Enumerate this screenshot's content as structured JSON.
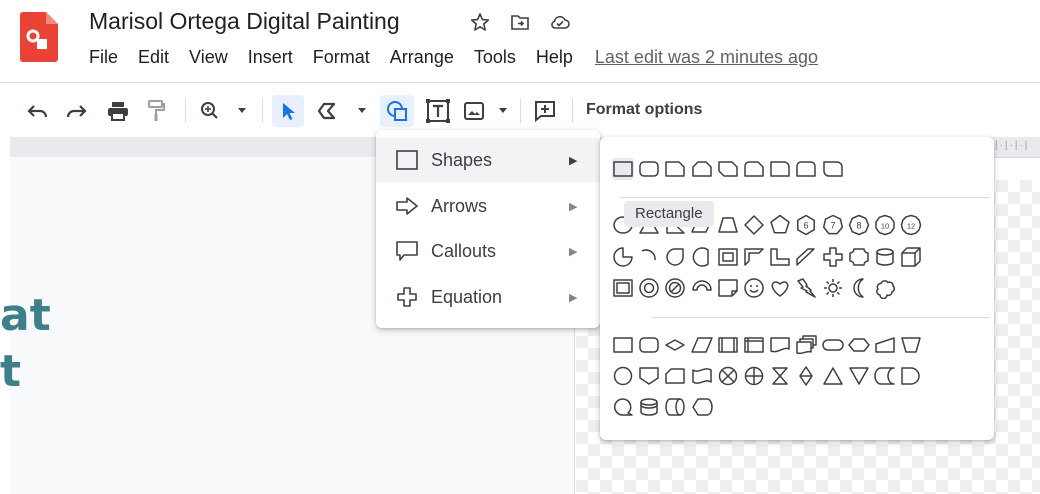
{
  "app": {
    "doc_title": "Marisol Ortega Digital Painting",
    "title_icons": [
      "star-icon",
      "move-to-folder-icon",
      "cloud-status-icon"
    ],
    "logo_icon": "drawings-logo-icon",
    "brand_color": "#ea4335"
  },
  "menubar": {
    "items": [
      "File",
      "Edit",
      "View",
      "Insert",
      "Format",
      "Arrange",
      "Tools",
      "Help"
    ],
    "last_edit": "Last edit was 2 minutes ago"
  },
  "toolbar": {
    "buttons": [
      "undo-icon",
      "redo-icon",
      "print-icon",
      "paint-format-icon",
      "zoom-icon",
      "select-icon",
      "line-icon",
      "shape-icon",
      "text-box-icon",
      "image-icon",
      "add-comment-icon"
    ],
    "format_options": "Format options",
    "active_tool": "shape-icon"
  },
  "background": {
    "fragment_line1": "at",
    "fragment_line2": "t"
  },
  "shape_menu": {
    "items": [
      {
        "label": "Shapes",
        "icon": "rectangle-icon",
        "active": true
      },
      {
        "label": "Arrows",
        "icon": "arrow-right-icon",
        "active": false
      },
      {
        "label": "Callouts",
        "icon": "callout-icon",
        "active": false
      },
      {
        "label": "Equation",
        "icon": "plus-icon",
        "active": false
      }
    ],
    "submenu_arrow": "▶"
  },
  "shapes_panel": {
    "tooltip": "Rectangle",
    "hovered_shape": "rectangle-shape",
    "groups": [
      {
        "name": "shapes",
        "rows": [
          [
            "rectangle",
            "rounded-rectangle",
            "snip-single-corner-rectangle",
            "snip-same-side-corner-rectangle",
            "snip-diagonal-corner-rectangle",
            "snip-and-round-single-corner-rectangle",
            "round-single-corner-rectangle",
            "round-same-side-corner-rectangle",
            "round-diagonal-corner-rectangle"
          ],
          [
            "oval",
            "triangle",
            "right-triangle",
            "parallelogram",
            "trapezoid",
            "diamond",
            "pentagon",
            "hexagon",
            "heptagon",
            "octagon",
            "decagon",
            "dodecagon"
          ],
          [
            "pie",
            "arc",
            "teardrop",
            "chord",
            "frame",
            "half-frame",
            "l-shape",
            "diagonal-stripe",
            "cross",
            "plaque",
            "can",
            "cube"
          ],
          [
            "bevel",
            "donut",
            "no-symbol",
            "block-arc",
            "folded-corner",
            "smiley-face",
            "heart",
            "lightning-bolt",
            "sun",
            "moon",
            "cloud"
          ]
        ]
      },
      {
        "name": "flowchart",
        "rows": [
          [
            "process",
            "alternate-process",
            "decision",
            "data",
            "predefined-process",
            "internal-storage",
            "document",
            "multidocument",
            "terminator",
            "preparation",
            "manual-input",
            "manual-operation"
          ],
          [
            "connector",
            "off-page-connector",
            "card",
            "punched-tape",
            "summing-junction",
            "or",
            "collate",
            "sort",
            "extract",
            "merge",
            "stored-data",
            "delay"
          ],
          [
            "sequential-access-storage",
            "magnetic-disk",
            "direct-access-storage",
            "display"
          ]
        ]
      }
    ],
    "polygon_numbers": [
      "6",
      "7",
      "8",
      "10",
      "12"
    ]
  }
}
